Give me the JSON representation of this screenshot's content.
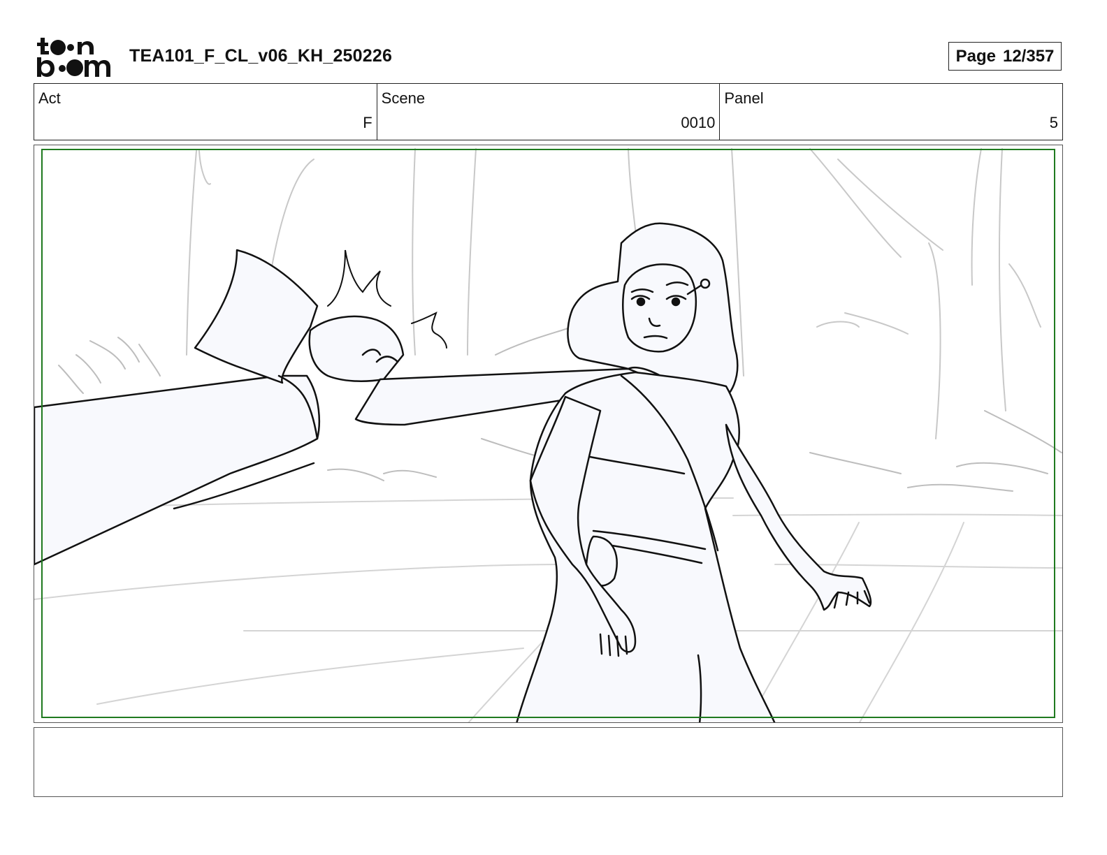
{
  "header": {
    "logo_text": "toon boom",
    "document_title": "TEA101_F_CL_v06_KH_250226",
    "page_label": "Page",
    "page_number": "12/357"
  },
  "info": {
    "act": {
      "label": "Act",
      "value": "F"
    },
    "scene": {
      "label": "Scene",
      "value": "0010"
    },
    "panel": {
      "label": "Panel",
      "value": "5"
    }
  },
  "panel_image": {
    "safe_frame_color": "#1f7a1f",
    "fill_color": "#f8f9fd"
  },
  "notes": {
    "text": ""
  }
}
